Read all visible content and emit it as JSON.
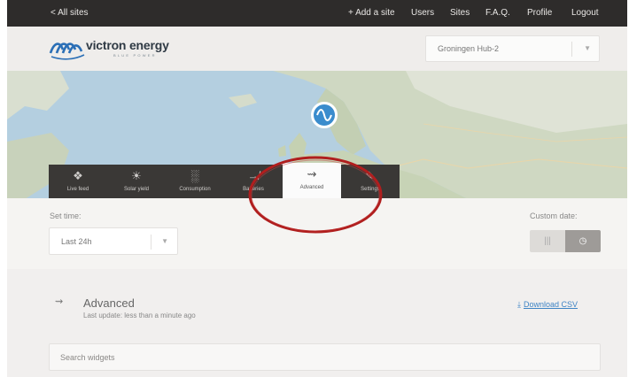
{
  "topbar": {
    "all_sites": "< All sites",
    "add_site": "+ Add a site",
    "users": "Users",
    "sites": "Sites",
    "faq": "F.A.Q.",
    "profile": "Profile",
    "logout": "Logout"
  },
  "header": {
    "logo_text": "victron energy",
    "logo_sub": "BLUE POWER",
    "site_select": "Groningen Hub-2"
  },
  "tabs": [
    {
      "label": "Live feed",
      "icon": "live-feed-icon"
    },
    {
      "label": "Solar yield",
      "icon": "sun-icon"
    },
    {
      "label": "Consumption",
      "icon": "bar-chart-icon"
    },
    {
      "label": "Batteries",
      "icon": "battery-icon"
    },
    {
      "label": "Advanced",
      "icon": "advanced-icon",
      "active": true
    },
    {
      "label": "Settings",
      "icon": "wrench-icon"
    }
  ],
  "controls": {
    "set_time_label": "Set time:",
    "time_value": "Last 24h",
    "custom_date_label": "Custom date:"
  },
  "advanced": {
    "title": "Advanced",
    "last_update": "Last update: less than a minute ago",
    "download": "Download CSV"
  },
  "search": {
    "placeholder": "Search widgets"
  },
  "colors": {
    "topbar": "#2e2c2b",
    "tab_dark": "#3a3836",
    "marker": "#3a8ccd",
    "link": "#3f84c5",
    "annotation": "#b01e1e"
  }
}
